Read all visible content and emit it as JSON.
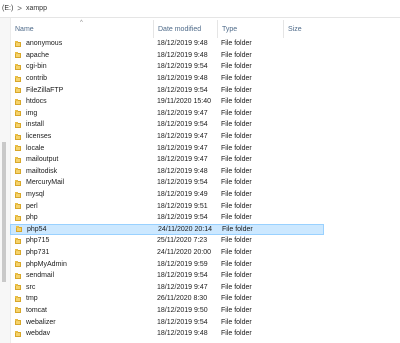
{
  "address_bar": {
    "drive": "(E:)",
    "separator": ">",
    "folder": "xampp"
  },
  "columns": {
    "name": "Name",
    "date_modified": "Date modified",
    "type": "Type",
    "size": "Size"
  },
  "files": [
    {
      "name": "anonymous",
      "date": "18/12/2019 9:48",
      "type": "File folder"
    },
    {
      "name": "apache",
      "date": "18/12/2019 9:48",
      "type": "File folder"
    },
    {
      "name": "cgi-bin",
      "date": "18/12/2019 9:54",
      "type": "File folder"
    },
    {
      "name": "contrib",
      "date": "18/12/2019 9:48",
      "type": "File folder"
    },
    {
      "name": "FileZillaFTP",
      "date": "18/12/2019 9:54",
      "type": "File folder"
    },
    {
      "name": "htdocs",
      "date": "19/11/2020 15:40",
      "type": "File folder"
    },
    {
      "name": "img",
      "date": "18/12/2019 9:47",
      "type": "File folder"
    },
    {
      "name": "install",
      "date": "18/12/2019 9:54",
      "type": "File folder"
    },
    {
      "name": "licenses",
      "date": "18/12/2019 9:47",
      "type": "File folder"
    },
    {
      "name": "locale",
      "date": "18/12/2019 9:47",
      "type": "File folder"
    },
    {
      "name": "mailoutput",
      "date": "18/12/2019 9:47",
      "type": "File folder"
    },
    {
      "name": "mailtodisk",
      "date": "18/12/2019 9:48",
      "type": "File folder"
    },
    {
      "name": "MercuryMail",
      "date": "18/12/2019 9:54",
      "type": "File folder"
    },
    {
      "name": "mysql",
      "date": "18/12/2019 9:49",
      "type": "File folder"
    },
    {
      "name": "perl",
      "date": "18/12/2019 9:51",
      "type": "File folder"
    },
    {
      "name": "php",
      "date": "18/12/2019 9:54",
      "type": "File folder"
    },
    {
      "name": "php54",
      "date": "24/11/2020 20:14",
      "type": "File folder",
      "selected": true
    },
    {
      "name": "php715",
      "date": "25/11/2020 7:23",
      "type": "File folder"
    },
    {
      "name": "php731",
      "date": "24/11/2020 20:00",
      "type": "File folder"
    },
    {
      "name": "phpMyAdmin",
      "date": "18/12/2019 9:59",
      "type": "File folder"
    },
    {
      "name": "sendmail",
      "date": "18/12/2019 9:54",
      "type": "File folder"
    },
    {
      "name": "src",
      "date": "18/12/2019 9:47",
      "type": "File folder"
    },
    {
      "name": "tmp",
      "date": "26/11/2020 8:30",
      "type": "File folder"
    },
    {
      "name": "tomcat",
      "date": "18/12/2019 9:50",
      "type": "File folder"
    },
    {
      "name": "webalizer",
      "date": "18/12/2019 9:54",
      "type": "File folder"
    },
    {
      "name": "webdav",
      "date": "18/12/2019 9:48",
      "type": "File folder"
    }
  ]
}
